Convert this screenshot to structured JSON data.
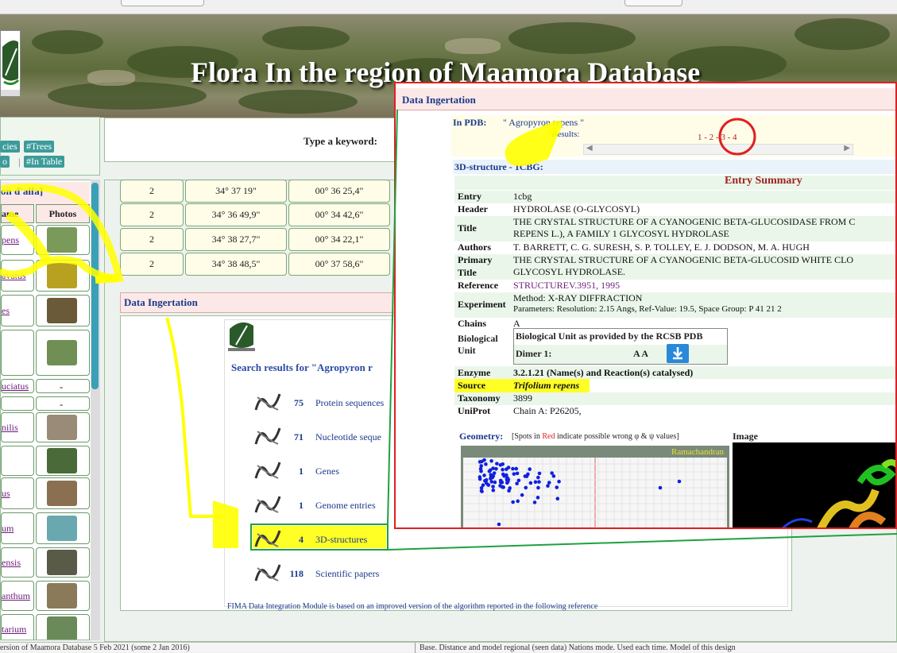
{
  "site": {
    "title": "Flora In the region of Maamora Database"
  },
  "left_panel": {
    "tags": [
      "cies",
      "#Trees",
      "o",
      "#In Table"
    ],
    "list_title": "on d'alfa]",
    "col_name": "ame",
    "col_photos": "Photos",
    "items": [
      {
        "name": "pens",
        "photo": "#7a9a5a"
      },
      {
        "name": "avatus",
        "photo": "#b8a020"
      },
      {
        "name": "es",
        "photo": "#6a5a3a"
      },
      {
        "name": "",
        "photo": "#6f8f55"
      },
      {
        "name": "uciatus",
        "photo": "-"
      },
      {
        "name": "",
        "photo": "-"
      },
      {
        "name": "nilis",
        "photo": "#9a8a78"
      },
      {
        "name": "",
        "photo": "#4a6a3a"
      },
      {
        "name": "us",
        "photo": "#8a7050"
      },
      {
        "name": "um",
        "photo": "#6aa8b0"
      },
      {
        "name": "ensis",
        "photo": "#5a5a48"
      },
      {
        "name": "anthum",
        "photo": "#8a7a5a"
      },
      {
        "name": "tarium",
        "photo": "#6a8a5a"
      }
    ]
  },
  "search": {
    "label": "Type a keyword:"
  },
  "coords": [
    {
      "n": "2",
      "lat": "34° 37 19\"",
      "lon": "00° 36 25,4\""
    },
    {
      "n": "2",
      "lat": "34° 36 49,9\"",
      "lon": "00° 34 42,6\""
    },
    {
      "n": "2",
      "lat": "34° 38 27,7\"",
      "lon": "00° 34 22,1\""
    },
    {
      "n": "2",
      "lat": "34° 38 48,5\"",
      "lon": "00° 37 58,6\""
    }
  ],
  "data_integration": {
    "title": "Data Ingertation",
    "search_heading": "Search results for \"Agropyron r",
    "rows": [
      {
        "count": "75",
        "label": "Protein sequences",
        "icon": "protein-icon"
      },
      {
        "count": "71",
        "label": "Nucleotide seque",
        "icon": "nucleotide-icon"
      },
      {
        "count": "1",
        "label": "Genes",
        "icon": "genes-icon"
      },
      {
        "count": "1",
        "label": "Genome entries",
        "icon": "genome-icon"
      },
      {
        "count": "4",
        "label": "3D-structures",
        "icon": "structure-icon"
      },
      {
        "count": "118",
        "label": "Scientific papers",
        "icon": "papers-icon"
      }
    ],
    "footnote": "FIMA Data Integration Module is based on an improved version of the algorithm reported in the following reference"
  },
  "popup": {
    "title": "Data Ingertation",
    "pdb_label": "In PDB:",
    "pdb_query": "\" Agropyron repens \"",
    "results_label": "Results:",
    "pages": "1 - 2 - 3 - 4",
    "structure_label": "3D-structure - 1CBG:",
    "summary_title": "Entry Summary",
    "fields": [
      {
        "key": "Entry",
        "value": "1cbg"
      },
      {
        "key": "Header",
        "value": "HYDROLASE (O-GLYCOSYL)"
      },
      {
        "key": "Title",
        "value": "THE CRYSTAL STRUCTURE OF A CYANOGENIC BETA-GLUCOSIDASE FROM C",
        "value2": "REPENS L.), A FAMILY 1 GLYCOSYL HYDROLASE"
      },
      {
        "key": "Authors",
        "value": "T. BARRETT, C. G. SURESH, S. P. TOLLEY, E. J. DODSON, M. A. HUGH"
      },
      {
        "key": "Primary",
        "key2": "Title",
        "value": "THE CRYSTAL STRUCTURE OF A CYANOGENIC BETA-GLUCOSID WHITE CLO",
        "value2": "GLYCOSYL HYDROLASE."
      },
      {
        "key": "Reference",
        "value": "STRUCTUREV.3951, 1995"
      },
      {
        "key": "Experiment",
        "value": "Method: X-RAY DIFFRACTION",
        "value2": "Parameters: Resolution: 2.15 Angs, Ref-Value: 19.5, Space Group: P 41 21 2"
      },
      {
        "key": "Chains",
        "value": "A"
      }
    ],
    "bio_unit_key": "Biological Unit",
    "bio_unit_title": "Biological Unit as provided by the RCSB PDB",
    "dimer_label": "Dimer 1:",
    "dimer_chains": "A A",
    "enzyme": {
      "key": "Enzyme",
      "value": "3.2.1.21 (Name(s) and Reaction(s) catalysed)"
    },
    "source": {
      "key": "Source",
      "value": "Trifolium repens"
    },
    "taxonomy": {
      "key": "Taxonomy",
      "value": "3899"
    },
    "uniprot": {
      "key": "UniProt",
      "value": "Chain A: P26205,"
    },
    "geometry_label": "Geometry:",
    "geometry_note_a": "[Spots in ",
    "geometry_note_red": "Red",
    "geometry_note_b": " indicate possible wrong φ & ψ values]",
    "ramachandran_label": "Ramachandran",
    "image_label": "Image"
  },
  "status": {
    "left": "ersion of Maamora Database 5 Feb 2021 (some 2 Jan 2016)",
    "right": "Base. Distance and model regional (seen data) Nations mode. Used each time. Model of this design"
  }
}
